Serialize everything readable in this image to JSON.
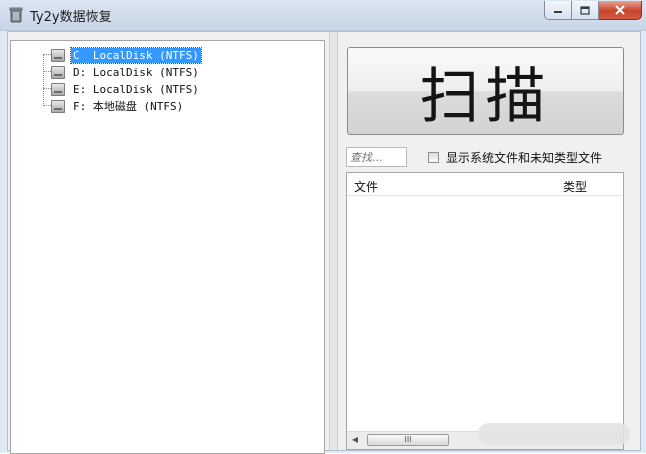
{
  "window": {
    "title": "Ty2y数据恢复",
    "icon": "trash-bin-icon",
    "controls": {
      "minimize": "minimize-icon",
      "maximize": "maximize-icon",
      "close": "close-icon"
    }
  },
  "tree": {
    "items": [
      {
        "label": "C  LocalDisk (NTFS)",
        "selected": true
      },
      {
        "label": "D: LocalDisk (NTFS)",
        "selected": false
      },
      {
        "label": "E: LocalDisk (NTFS)",
        "selected": false
      },
      {
        "label": "F: 本地磁盘 (NTFS)",
        "selected": false
      }
    ]
  },
  "scan": {
    "label": "扫描"
  },
  "search": {
    "placeholder": "查找..."
  },
  "filter": {
    "label": "显示系统文件和未知类型文件",
    "checked": false
  },
  "file_list": {
    "columns": [
      "文件",
      "类型"
    ],
    "rows": [],
    "scroll_thumb_glyph": "III",
    "scroll_left_glyph": "◀"
  },
  "colors": {
    "selection": "#3399ff",
    "close_button": "#c7432b"
  }
}
